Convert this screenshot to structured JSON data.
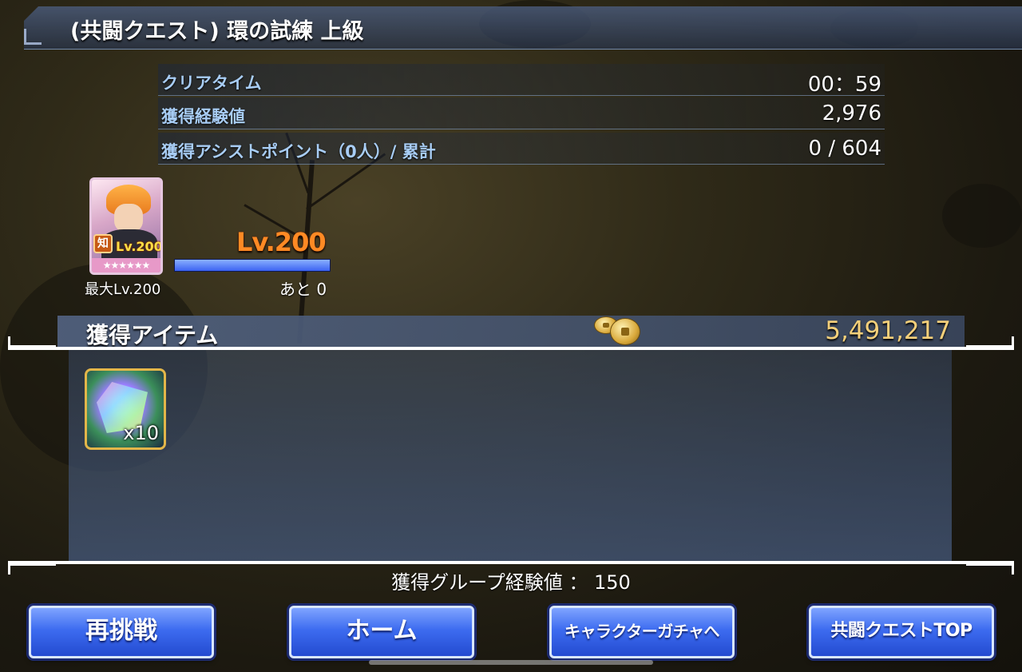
{
  "quest": {
    "title": "(共闘クエスト) 環の試練 上級"
  },
  "stats": [
    {
      "label": "クリアタイム",
      "value": "00：59"
    },
    {
      "label": "獲得経験値",
      "value": "2,976"
    },
    {
      "label": "獲得アシストポイント（0人）/ 累計",
      "value": "0 / 604"
    }
  ],
  "character": {
    "attribute_label": "知",
    "card_level": "Lv.200",
    "stars": "★★★★★★",
    "max_level_label": "最大Lv.200",
    "level_display": "Lv.200",
    "exp_remaining": "あと 0",
    "exp_progress": 1.0
  },
  "items": {
    "header_label": "獲得アイテム",
    "coin_total": "5,491,217",
    "coin_icon": "coin-icon",
    "list": [
      {
        "icon": "rainbow-crystal-icon",
        "quantity": "x10"
      }
    ]
  },
  "group_exp": "獲得グループ経験値 ： 150",
  "buttons": {
    "retry": "再挑戦",
    "home": "ホーム",
    "gacha": "キャラクターガチャへ",
    "coop_top": "共闘クエストTOP"
  },
  "colors": {
    "stat_label": "#a8cdf5",
    "coin_total": "#f5d07a",
    "level": "#ff8a24",
    "button": "#3d6cf0"
  }
}
